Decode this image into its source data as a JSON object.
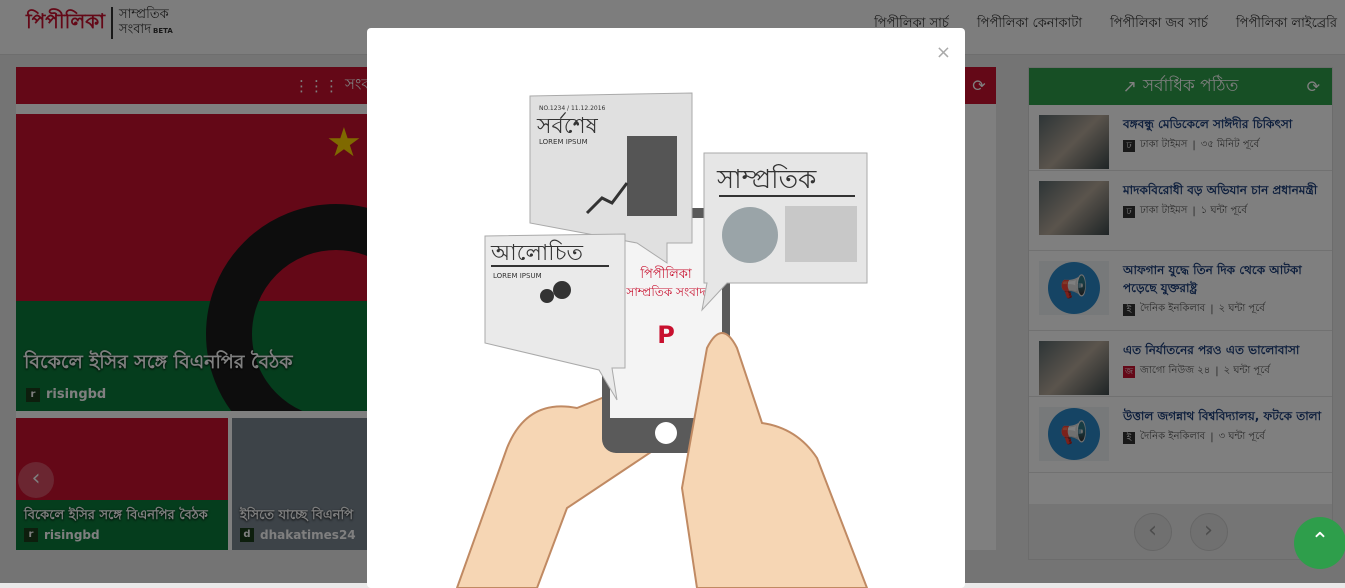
{
  "header": {
    "logo": "পিপীলিকা",
    "logo_sub_line1": "সাম্প্রতিক",
    "logo_sub_line2": "সংবাদ",
    "logo_beta": "BETA",
    "nav": [
      "পিপীলিকা সার্চ",
      "পিপীলিকা কেনাকাটা",
      "পিপীলিকা জব সার্চ",
      "পিপীলিকা লাইব্রেরি"
    ]
  },
  "left": {
    "header": "সংবাদশ",
    "hero_title": "বিকেলে ইসির সঙ্গে বিএনপির বৈঠক",
    "hero_source": "risingbd",
    "thumbs": [
      {
        "title": "বিকেলে ইসির সঙ্গে বিএনপির বৈঠক",
        "source": "risingbd"
      },
      {
        "title": "ইসিতে যাচ্ছে বিএনপি",
        "source": "dhakatimes24"
      }
    ]
  },
  "right": {
    "header": "সর্বাধিক পঠিত",
    "items": [
      {
        "title": "বঙ্গবন্ধু মেডিকেলে সাঈদীর চিকিৎসা",
        "source": "ঢাকা টাইমস",
        "time": "৩৫ মিনিট পূর্বে"
      },
      {
        "title": "মাদকবিরোধী বড় অভিযান চান প্রধানমন্ত্রী",
        "source": "ঢাকা টাইমস",
        "time": "১ ঘন্টা পূর্বে"
      },
      {
        "title": "আফগান যুদ্ধে তিন দিক থেকে আটকা পড়েছে যুক্তরাষ্ট্র",
        "source": "দৈনিক ইনকিলাব",
        "time": "২ ঘন্টা পূর্বে"
      },
      {
        "title": "এত নির্যাতনের পরও এত ভালোবাসা",
        "source": "জাগো নিউজ ২৪",
        "time": "২ ঘন্টা পূর্বে"
      },
      {
        "title": "উত্তাল জগন্নাথ বিশ্ববিদ্যালয়, ফটকে তালা",
        "source": "দৈনিক ইনকিলাব",
        "time": "৩ ঘন্টা পূর্বে"
      }
    ]
  },
  "modal": {
    "close": "×",
    "card_latest": "সর্বশেষ",
    "card_recent": "সাম্প্রতিক",
    "card_discussed": "আলোচিত",
    "phone_brand": "পিপীলিকা",
    "phone_sub": "সাম্প্রতিক সংবাদ",
    "lorem": "LOREM IPSUM",
    "issue": "NO.1234 / 11.12.2016"
  }
}
